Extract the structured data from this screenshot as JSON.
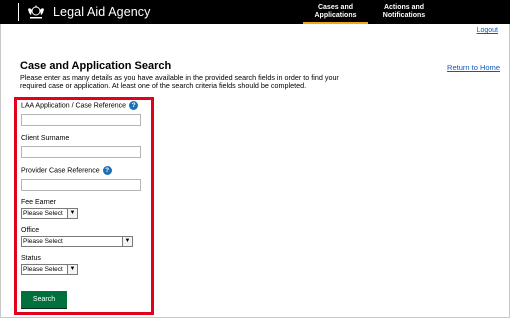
{
  "header": {
    "brand": "Legal Aid Agency",
    "nav": [
      {
        "line1": "Cases and",
        "line2": "Applications"
      },
      {
        "line1": "Actions and",
        "line2": "Notifications"
      }
    ],
    "logout": "Logout"
  },
  "page": {
    "title": "Case and Application Search",
    "intro": "Please enter as many details as you have available in the provided search fields in order to find your required case or application. At least one of the search criteria fields should be completed.",
    "return_link": "Return to Home"
  },
  "form": {
    "laa_ref_label": "LAA Application / Case Reference",
    "laa_ref_value": "",
    "client_surname_label": "Client Surname",
    "client_surname_value": "",
    "provider_ref_label": "Provider Case Reference",
    "provider_ref_value": "",
    "fee_earner_label": "Fee Earner",
    "fee_earner_value": "Please Select",
    "office_label": "Office",
    "office_value": "Please Select",
    "status_label": "Status",
    "status_value": "Please Select",
    "search_button": "Search"
  },
  "colors": {
    "header_bg": "#000000",
    "link": "#0b58c5",
    "highlight": "#e2001a",
    "button": "#00703c",
    "help_icon": "#1d70b8",
    "active_tab": "#f3a51a"
  },
  "icons": {
    "crest": "royal-crest-icon",
    "help": "question-circle-icon",
    "select_arrow": "chevron-down-icon"
  }
}
